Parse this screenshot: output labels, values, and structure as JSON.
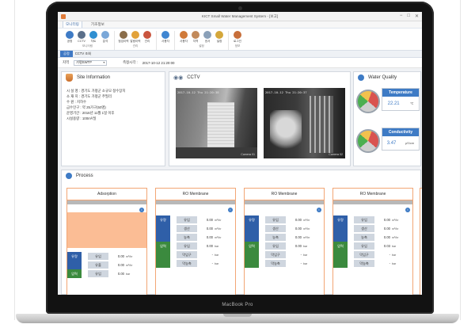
{
  "window": {
    "title": "KICT Small Water Management System - [보고]",
    "controls": [
      "−",
      "□",
      "✕"
    ]
  },
  "ribbon_tabs": [
    "모니터링",
    "기초정보"
  ],
  "ribbon_groups": [
    {
      "label": "모니터링",
      "buttons": [
        {
          "label": "공정",
          "icon": "process-icon",
          "color": "#3e7bc5"
        },
        {
          "label": "CCTV",
          "icon": "cctv-icon",
          "color": "#5a6f8a"
        },
        {
          "label": "차트",
          "icon": "chart-icon",
          "color": "#2f8fd1"
        },
        {
          "label": "분석",
          "icon": "analysis-icon",
          "color": "#7aa7d8"
        }
      ]
    },
    {
      "label": "관리",
      "buttons": [
        {
          "label": "점검이력",
          "icon": "inspect-icon",
          "color": "#8a6d4a"
        },
        {
          "label": "알람이력",
          "icon": "alarm-icon",
          "color": "#e2a23a"
        },
        {
          "label": "관리",
          "icon": "manage-icon",
          "color": "#c9553e"
        }
      ]
    },
    {
      "label": "",
      "buttons": [
        {
          "label": "사용자",
          "icon": "user-manage-icon",
          "color": "#3f86d1"
        }
      ]
    },
    {
      "label": "설정",
      "buttons": [
        {
          "label": "사용자",
          "icon": "user-icon",
          "color": "#d07a39"
        },
        {
          "label": "지역",
          "icon": "region-icon",
          "color": "#c28a5b"
        },
        {
          "label": "센서",
          "icon": "sensor-icon",
          "color": "#8aa0b8"
        },
        {
          "label": "설정",
          "icon": "settings-icon",
          "color": "#d4a73b"
        }
      ]
    },
    {
      "label": "정보",
      "buttons": [
        {
          "label": "로그인",
          "icon": "login-icon",
          "color": "#c76f3a"
        }
      ]
    }
  ],
  "doc_tab": {
    "badge": "공정",
    "label": "CCTV 조회"
  },
  "filter": {
    "region_label": "지역",
    "region_value": "가평SWTP",
    "time_label": "측정시각 :",
    "time_value": "2017-10-12 21:20:00"
  },
  "site_info": {
    "title": "Site Information",
    "lines": [
      "시 설 명 : 경기도 가평군 소규모 정수장치",
      "소 재 지 : 경기도 가평군 주필리",
      "수    원 : 지하수",
      "급수인구 : 약 25가구(50명)",
      "운영기간 : 2016년 11월 1일 이후",
      "시설용량 : 100m³/일"
    ]
  },
  "cctv": {
    "title": "CCTV",
    "cameras": [
      {
        "timestamp": "2017-10-12 Thu 21:20:38",
        "name": "Camera 01"
      },
      {
        "timestamp": "2017-10-12 Thu 21:20:37",
        "name": "Camera 02"
      }
    ]
  },
  "water_quality": {
    "title": "Water Quality",
    "metrics": [
      {
        "name": "Temperature",
        "value": "22.21",
        "unit": "℃"
      },
      {
        "name": "Conductivity",
        "value": "3.47",
        "unit": "µS/cm"
      }
    ]
  },
  "process": {
    "title": "Process",
    "cards": [
      {
        "title": "Adsorption",
        "rows": [
          {
            "cat": "유량",
            "label": "유입",
            "value": "0.00",
            "unit": "m³/hr"
          },
          {
            "cat": "",
            "label": "유출",
            "value": "0.00",
            "unit": "m³/hr"
          },
          {
            "cat": "압력",
            "label": "유입",
            "value": "0.00",
            "unit": "bar"
          }
        ]
      },
      {
        "title": "RO Membrane",
        "rows": [
          {
            "cat": "유량",
            "label": "유입",
            "value": "0.00",
            "unit": "m³/hr"
          },
          {
            "cat": "",
            "label": "생산",
            "value": "0.00",
            "unit": "m³/hr"
          },
          {
            "cat": "",
            "label": "농축",
            "value": "0.00",
            "unit": "m³/hr"
          },
          {
            "cat": "압력",
            "label": "유입",
            "value": "0.00",
            "unit": "bar"
          },
          {
            "cat": "",
            "label": "막입구",
            "value": "-",
            "unit": "bar"
          },
          {
            "cat": "",
            "label": "막농축",
            "value": "-",
            "unit": "bar"
          }
        ]
      },
      {
        "title": "RO Membrane",
        "rows": [
          {
            "cat": "유량",
            "label": "유입",
            "value": "0.00",
            "unit": "m³/hr"
          },
          {
            "cat": "",
            "label": "생산",
            "value": "0.00",
            "unit": "m³/hr"
          },
          {
            "cat": "",
            "label": "농축",
            "value": "0.00",
            "unit": "m³/hr"
          },
          {
            "cat": "압력",
            "label": "유입",
            "value": "0.00",
            "unit": "bar"
          },
          {
            "cat": "",
            "label": "막입구",
            "value": "-",
            "unit": "bar"
          },
          {
            "cat": "",
            "label": "막농축",
            "value": "-",
            "unit": "bar"
          }
        ]
      },
      {
        "title": "RO Membrane",
        "rows": [
          {
            "cat": "유량",
            "label": "유입",
            "value": "0.00",
            "unit": "m³/hr"
          },
          {
            "cat": "",
            "label": "생산",
            "value": "0.00",
            "unit": "m³/hr"
          },
          {
            "cat": "",
            "label": "농축",
            "value": "0.00",
            "unit": "m³/hr"
          },
          {
            "cat": "압력",
            "label": "유입",
            "value": "0.03",
            "unit": "bar"
          },
          {
            "cat": "",
            "label": "막입구",
            "value": "-",
            "unit": "bar"
          },
          {
            "cat": "",
            "label": "막농축",
            "value": "-",
            "unit": "bar"
          }
        ]
      }
    ]
  },
  "device": {
    "name": "MacBook Pro"
  },
  "colors": {
    "accent": "#3e7bc5",
    "orange": "#f2a675",
    "flow": "#2f5fa8",
    "pressure": "#3b8a3e"
  }
}
